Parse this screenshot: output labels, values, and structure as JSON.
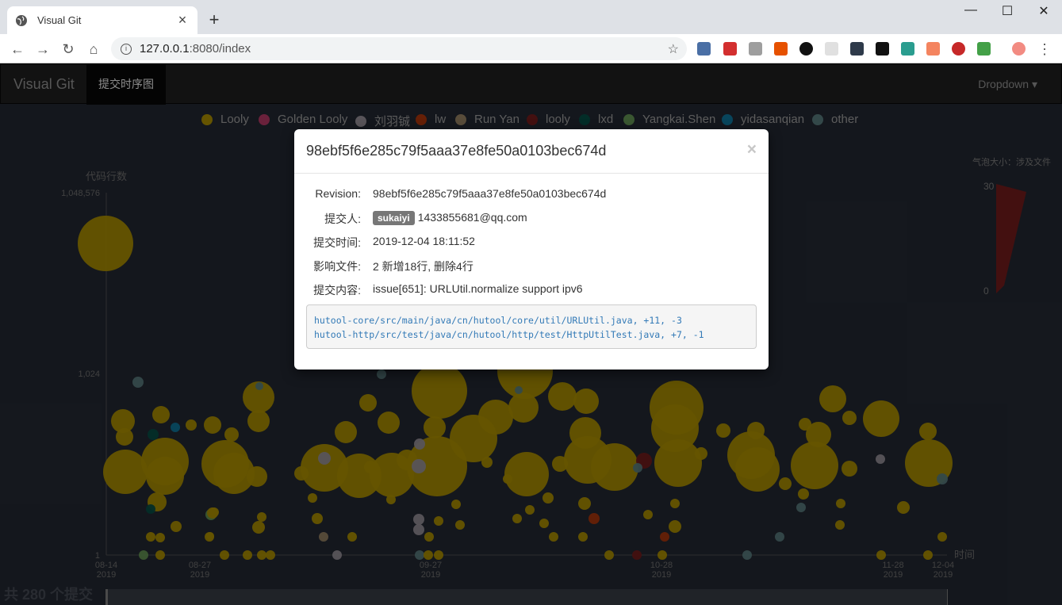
{
  "browser": {
    "tab_title": "Visual Git",
    "url_host": "127.0.0.1",
    "url_rest": ":8080/index",
    "new_tab": "+",
    "close_tab": "×",
    "window_minimize": "—",
    "window_maximize": "☐",
    "window_close": "✕"
  },
  "navbar": {
    "brand": "Visual Git",
    "active_item": "提交时序图",
    "dropdown": "Dropdown ▾"
  },
  "chart_data": {
    "type": "scatter",
    "legend": [
      {
        "name": "Looly",
        "color": "#b89a00"
      },
      {
        "name": "Golden Looly",
        "color": "#c23c6c"
      },
      {
        "name": "刘羽铖",
        "color": "#a09aa3"
      },
      {
        "name": "lw",
        "color": "#b83a0c"
      },
      {
        "name": "Run Yan",
        "color": "#a08a6a"
      },
      {
        "name": "looly",
        "color": "#7a1e1e"
      },
      {
        "name": "lxd",
        "color": "#06524a"
      },
      {
        "name": "Yangkai.Shen",
        "color": "#6a9e5a"
      },
      {
        "name": "yidasanqian",
        "color": "#0f7ea8"
      },
      {
        "name": "other",
        "color": "#5e8486"
      }
    ],
    "ylabel": "代码行数",
    "xlabel": "时间",
    "y_scale": "log",
    "y_ticks": [
      "1,048,576",
      "1,024",
      "1"
    ],
    "x_ticks": [
      {
        "date": "08-14",
        "year": "2019"
      },
      {
        "date": "08-27",
        "year": "2019"
      },
      {
        "date": "09-27",
        "year": "2019"
      },
      {
        "date": "10-28",
        "year": "2019"
      },
      {
        "date": "11-28",
        "year": "2019"
      },
      {
        "date": "12-04",
        "year": "2019"
      }
    ],
    "visual_map": {
      "title": "气泡大小：涉及文件",
      "max": "30",
      "min": "0"
    }
  },
  "commit_count_label": "共 280 个提交",
  "modal": {
    "title": "98ebf5f6e285c79f5aaa37e8fe50a0103bec674d",
    "close": "×",
    "revision_label": "Revision:",
    "revision": "98ebf5f6e285c79f5aaa37e8fe50a0103bec674d",
    "author_label": "提交人:",
    "author_badge": "sukaiyi",
    "author_email": "1433855681@qq.com",
    "time_label": "提交时间:",
    "time": "2019-12-04 18:11:52",
    "files_label": "影响文件:",
    "files_summary": "2 新增18行, 删除4行",
    "message_label": "提交内容:",
    "message": "issue[651]: URLUtil.normalize support ipv6",
    "file_list": [
      "hutool-core/src/main/java/cn/hutool/core/util/URLUtil.java, +11, -3",
      "hutool-http/src/test/java/cn/hutool/http/test/HttpUtilTest.java, +7, -1"
    ]
  }
}
